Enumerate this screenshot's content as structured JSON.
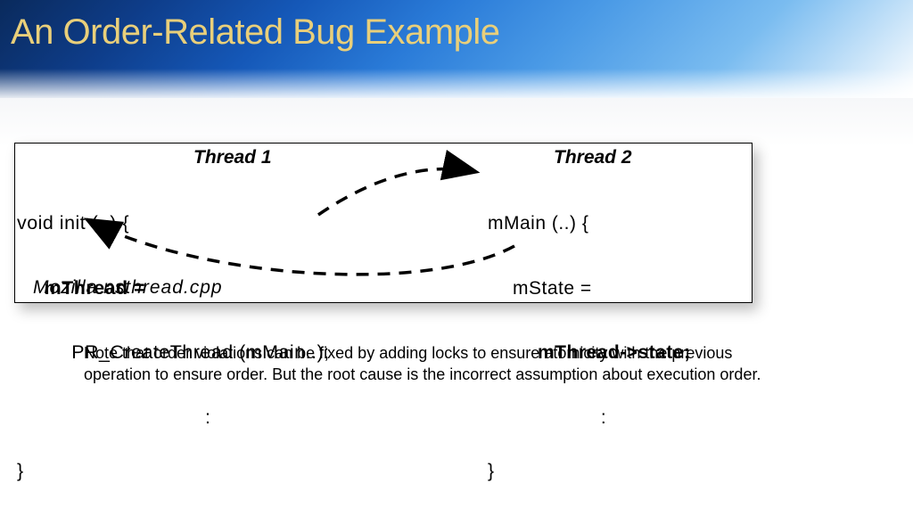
{
  "slide": {
    "title": "An Order-Related Bug Example",
    "figure": {
      "thread1_header": "Thread 1",
      "thread2_header": "Thread 2",
      "thread1": {
        "line1": "void init (..) {",
        "line2": "mThread =",
        "line3": "PR_CreateThread (mMain..);",
        "close_brace": "}"
      },
      "thread2": {
        "line1": "mMain (..) {",
        "line2": "mState =",
        "line3": "mThread->state;",
        "close_brace": "}"
      },
      "source_file": "Mozilla nsthread.cpp"
    },
    "note": "Note that order violations can be fixed by adding locks to ensure atomicity with the previous operation to ensure order.  But the root cause is the incorrect assumption about execution order."
  }
}
